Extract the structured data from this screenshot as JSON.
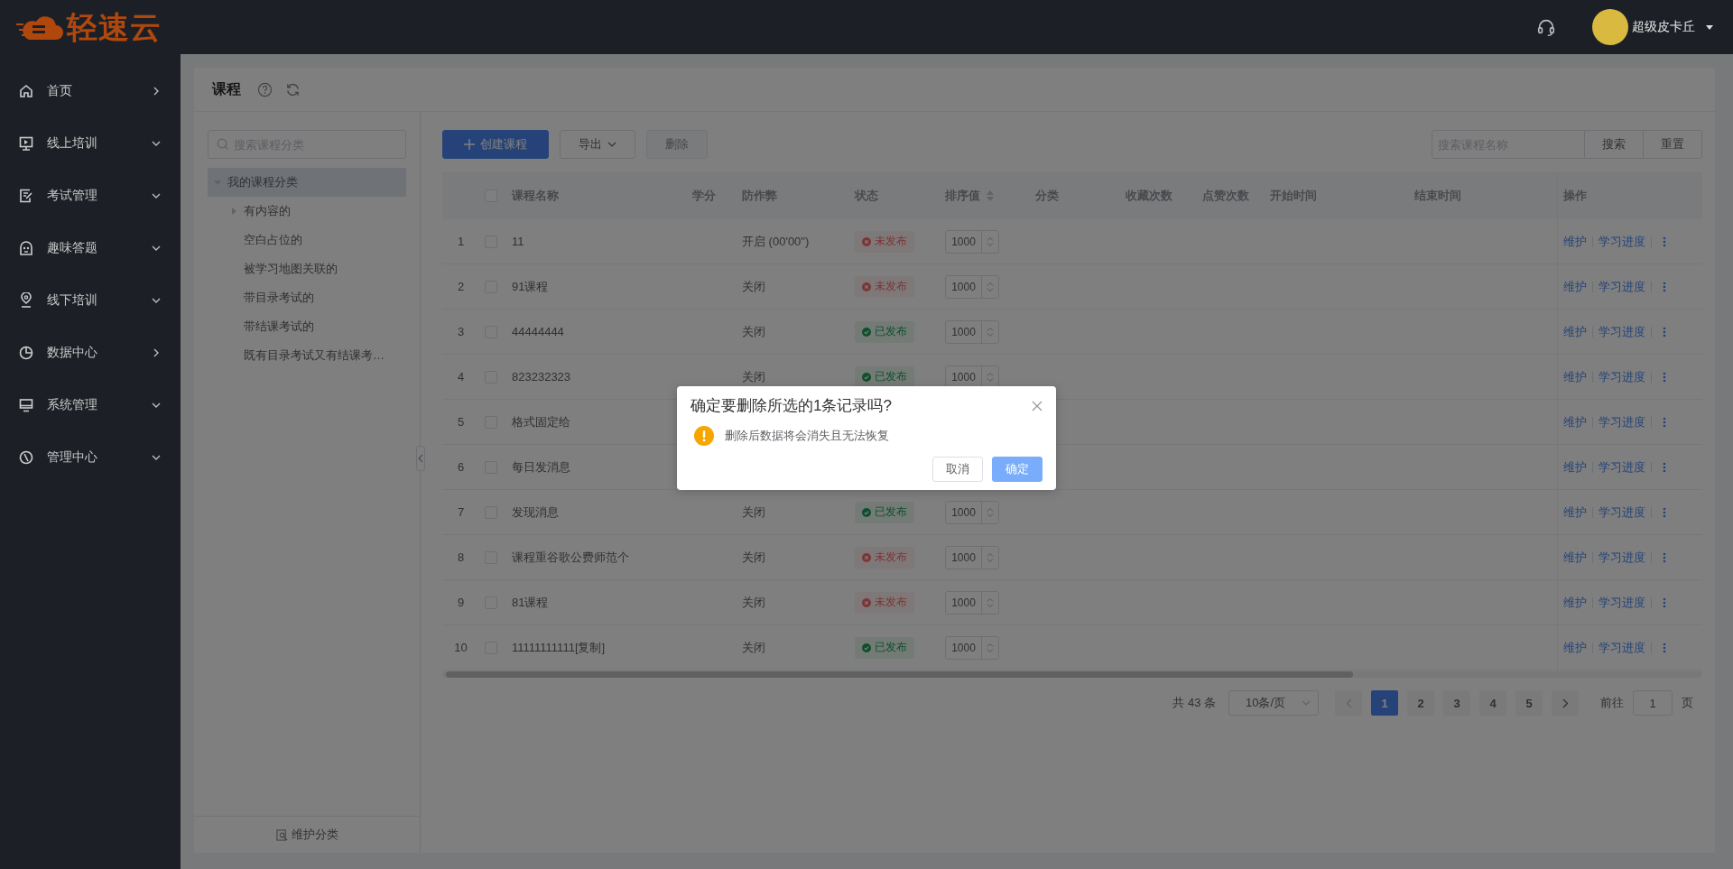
{
  "header": {
    "logo_text": "轻速云",
    "user_name": "超级皮卡丘"
  },
  "sidebar": {
    "items": [
      {
        "label": "首页",
        "kind": "link"
      },
      {
        "label": "线上培训",
        "kind": "submenu"
      },
      {
        "label": "考试管理",
        "kind": "submenu"
      },
      {
        "label": "趣味答题",
        "kind": "submenu"
      },
      {
        "label": "线下培训",
        "kind": "submenu"
      },
      {
        "label": "数据中心",
        "kind": "link"
      },
      {
        "label": "系统管理",
        "kind": "submenu"
      },
      {
        "label": "管理中心",
        "kind": "submenu"
      }
    ]
  },
  "page": {
    "title": "课程"
  },
  "category_panel": {
    "search": {
      "placeholder": "搜索课程分类"
    },
    "tree": [
      {
        "label": "我的课程分类",
        "selected": true,
        "expanded": true,
        "children": [
          {
            "label": "有内容的",
            "has_children": true
          },
          {
            "label": "空白占位的",
            "has_children": false
          },
          {
            "label": "被学习地图关联的",
            "has_children": false
          },
          {
            "label": "带目录考试的",
            "has_children": false
          },
          {
            "label": "带结课考试的",
            "has_children": false
          },
          {
            "label": "既有目录考试又有结课考…",
            "has_children": false
          }
        ]
      }
    ],
    "footer_link": "维护分类"
  },
  "toolbar": {
    "create": "创建课程",
    "export": "导出",
    "delete": {
      "label": "删除",
      "disabled": true
    },
    "search": {
      "placeholder": "搜索课程名称"
    },
    "search_button": "搜索",
    "reset_button": "重置"
  },
  "table": {
    "header_checked": false,
    "columns": [
      {
        "label": "课程名称",
        "sortable": false
      },
      {
        "label": "学分",
        "sortable": false
      },
      {
        "label": "防作弊",
        "sortable": false
      },
      {
        "label": "状态",
        "sortable": false
      },
      {
        "label": "排序值",
        "sortable": true
      },
      {
        "label": "分类",
        "sortable": false
      },
      {
        "label": "收藏次数",
        "sortable": false
      },
      {
        "label": "点赞次数",
        "sortable": false
      },
      {
        "label": "开始时间",
        "sortable": false
      },
      {
        "label": "结束时间",
        "sortable": false
      },
      {
        "label": "操作",
        "sortable": false
      }
    ],
    "rows": [
      {
        "index": "1",
        "checked": false,
        "name": "11",
        "anti_cheat": "开启 (00'00\")",
        "status": {
          "label": "未发布",
          "published": false
        },
        "sort": "1000",
        "actions": [
          "维护",
          "学习进度"
        ]
      },
      {
        "index": "2",
        "checked": false,
        "name": "91课程",
        "anti_cheat": "关闭",
        "status": {
          "label": "未发布",
          "published": false
        },
        "sort": "1000",
        "actions": [
          "维护",
          "学习进度"
        ]
      },
      {
        "index": "3",
        "checked": false,
        "name": "44444444",
        "anti_cheat": "关闭",
        "status": {
          "label": "已发布",
          "published": true
        },
        "sort": "1000",
        "actions": [
          "维护",
          "学习进度"
        ]
      },
      {
        "index": "4",
        "checked": false,
        "name": "823232323",
        "anti_cheat": "关闭",
        "status": {
          "label": "已发布",
          "published": true
        },
        "sort": "1000",
        "actions": [
          "维护",
          "学习进度"
        ]
      },
      {
        "index": "5",
        "checked": false,
        "name": "格式固定给",
        "actions": [
          "维护",
          "学习进度"
        ]
      },
      {
        "index": "6",
        "checked": false,
        "name": "每日发消息",
        "actions": [
          "维护",
          "学习进度"
        ]
      },
      {
        "index": "7",
        "checked": false,
        "name": "发现消息",
        "anti_cheat": "关闭",
        "status": {
          "label": "已发布",
          "published": true
        },
        "sort": "1000",
        "actions": [
          "维护",
          "学习进度"
        ]
      },
      {
        "index": "8",
        "checked": false,
        "name": "课程重谷歌公费师范个",
        "anti_cheat": "关闭",
        "status": {
          "label": "未发布",
          "published": false
        },
        "sort": "1000",
        "actions": [
          "维护",
          "学习进度"
        ]
      },
      {
        "index": "9",
        "checked": false,
        "name": "81课程",
        "anti_cheat": "关闭",
        "status": {
          "label": "未发布",
          "published": false
        },
        "sort": "1000",
        "actions": [
          "维护",
          "学习进度"
        ]
      },
      {
        "index": "10",
        "checked": false,
        "name": "11111111111[复制]",
        "anti_cheat": "关闭",
        "status": {
          "label": "已发布",
          "published": true
        },
        "sort": "1000",
        "actions": [
          "维护",
          "学习进度"
        ]
      }
    ]
  },
  "pagination": {
    "total": "共 43 条",
    "page_size": "10条/页",
    "pages": [
      {
        "label": "1",
        "selected": true
      },
      {
        "label": "2",
        "selected": false
      },
      {
        "label": "3",
        "selected": false
      },
      {
        "label": "4",
        "selected": false
      },
      {
        "label": "5",
        "selected": false
      }
    ],
    "goto_label": "前往",
    "goto_value": "1",
    "page_suffix": "页"
  },
  "dialog": {
    "title": "确定要删除所选的1条记录吗?",
    "message": "删除后数据将会消失且无法恢复",
    "cancel": "取消",
    "confirm": "确定"
  }
}
